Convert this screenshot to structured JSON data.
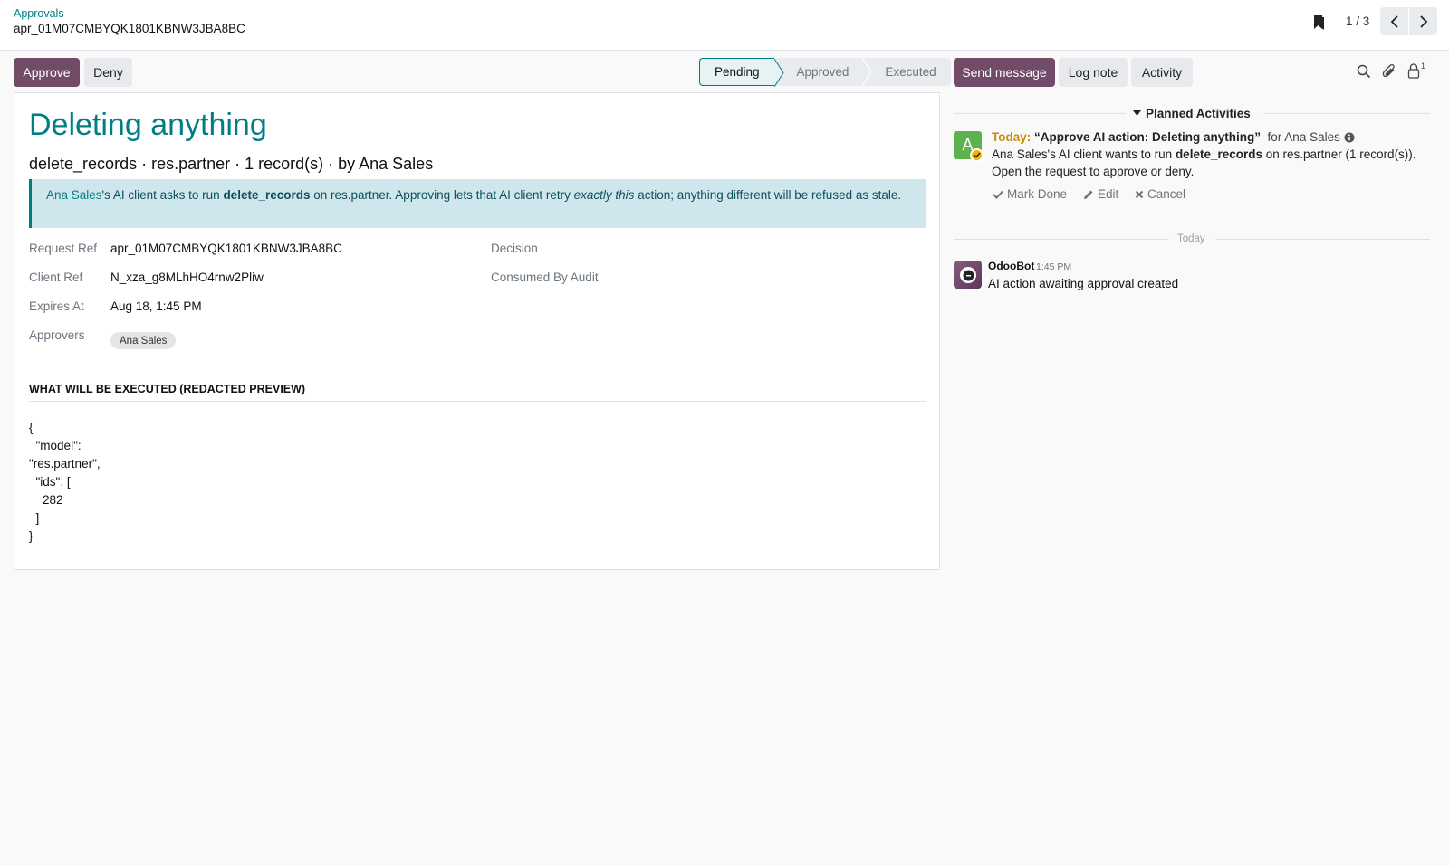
{
  "breadcrumb": {
    "parent": "Approvals",
    "current": "apr_01M07CMBYQK1801KBNW3JBA8BC"
  },
  "pager": {
    "value": "1 / 3"
  },
  "actions": {
    "approve": "Approve",
    "deny": "Deny"
  },
  "statusbar": {
    "stages": [
      "Pending",
      "Approved",
      "Executed"
    ],
    "active": "Pending"
  },
  "form": {
    "title": "Deleting anything",
    "subtitle": "delete_records · res.partner · 1 record(s) · by Ana Sales",
    "alert": {
      "who": "Ana Sales",
      "p1": "'s AI client asks to run ",
      "method": "delete_records",
      "p2": " on res.partner. Approving lets that AI client retry ",
      "emphasis": "exactly this",
      "p3": " action; anything different will be refused as stale."
    },
    "fields": {
      "request_ref_label": "Request Ref",
      "request_ref_value": "apr_01M07CMBYQK1801KBNW3JBA8BC",
      "client_ref_label": "Client Ref",
      "client_ref_value": "N_xza_g8MLhHO4rnw2Pliw",
      "expires_label": "Expires At",
      "expires_value": "Aug 18, 1:45 PM",
      "approvers_label": "Approvers",
      "approvers_value": "Ana Sales",
      "decision_label": "Decision",
      "consumed_label": "Consumed By Audit"
    },
    "section_title": "WHAT WILL BE EXECUTED (REDACTED PREVIEW)",
    "preview": "{\n  \"model\":\n\"res.partner\",\n  \"ids\": [\n    282\n  ]\n}"
  },
  "chatter": {
    "send_message": "Send message",
    "log_note": "Log note",
    "activity": "Activity",
    "followers_count": "1",
    "planned_title": "Planned Activities",
    "activity_item": {
      "avatar_letter": "A",
      "when": "Today:",
      "summary": "“Approve AI action: Deleting anything”",
      "for": "for Ana Sales",
      "body_p1": "Ana Sales's AI client wants to run ",
      "body_method": "delete_records",
      "body_p2": " on res.partner (1 record(s)). Open the request to approve or deny.",
      "mark_done": "Mark Done",
      "edit": "Edit",
      "cancel": "Cancel"
    },
    "separator": "Today",
    "message": {
      "author": "OdooBot",
      "time": "1:45 PM",
      "body": "AI action awaiting approval created"
    }
  },
  "colors": {
    "primary": "#714b67",
    "accent": "#017e84",
    "alert_bg": "#cfe7ec",
    "today": "#c49000"
  }
}
